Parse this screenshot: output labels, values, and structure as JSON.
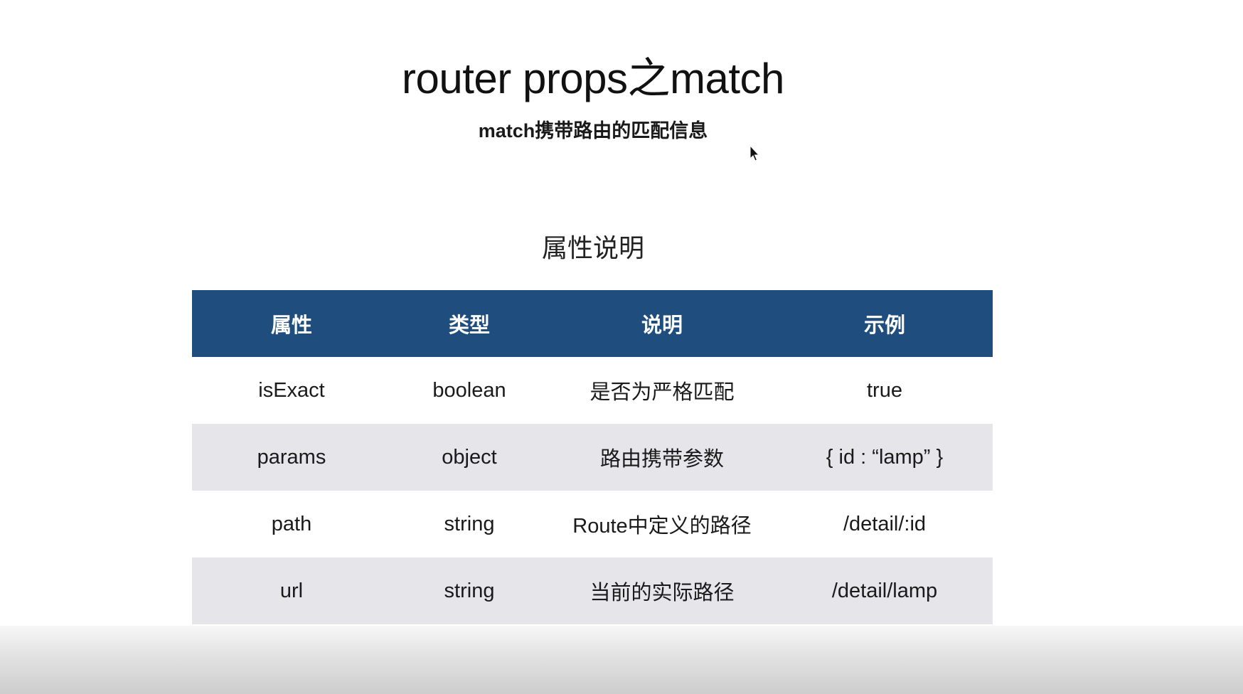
{
  "slide": {
    "title": "router props之match",
    "subtitle": "match携带路由的匹配信息",
    "section_heading": "属性说明"
  },
  "table": {
    "headers": [
      "属性",
      "类型",
      "说明",
      "示例"
    ],
    "rows": [
      [
        "isExact",
        "boolean",
        "是否为严格匹配",
        "true"
      ],
      [
        "params",
        "object",
        "路由携带参数",
        "{ id : “lamp” }"
      ],
      [
        "path",
        "string",
        "Route中定义的路径",
        "/detail/:id"
      ],
      [
        "url",
        "string",
        "当前的实际路径",
        "/detail/lamp"
      ]
    ]
  },
  "colors": {
    "header_background": "#1f4e7e",
    "header_text": "#ffffff",
    "alt_row_background": "#e5e5ea"
  },
  "icons": {
    "cursor": "mouse-pointer-icon"
  }
}
